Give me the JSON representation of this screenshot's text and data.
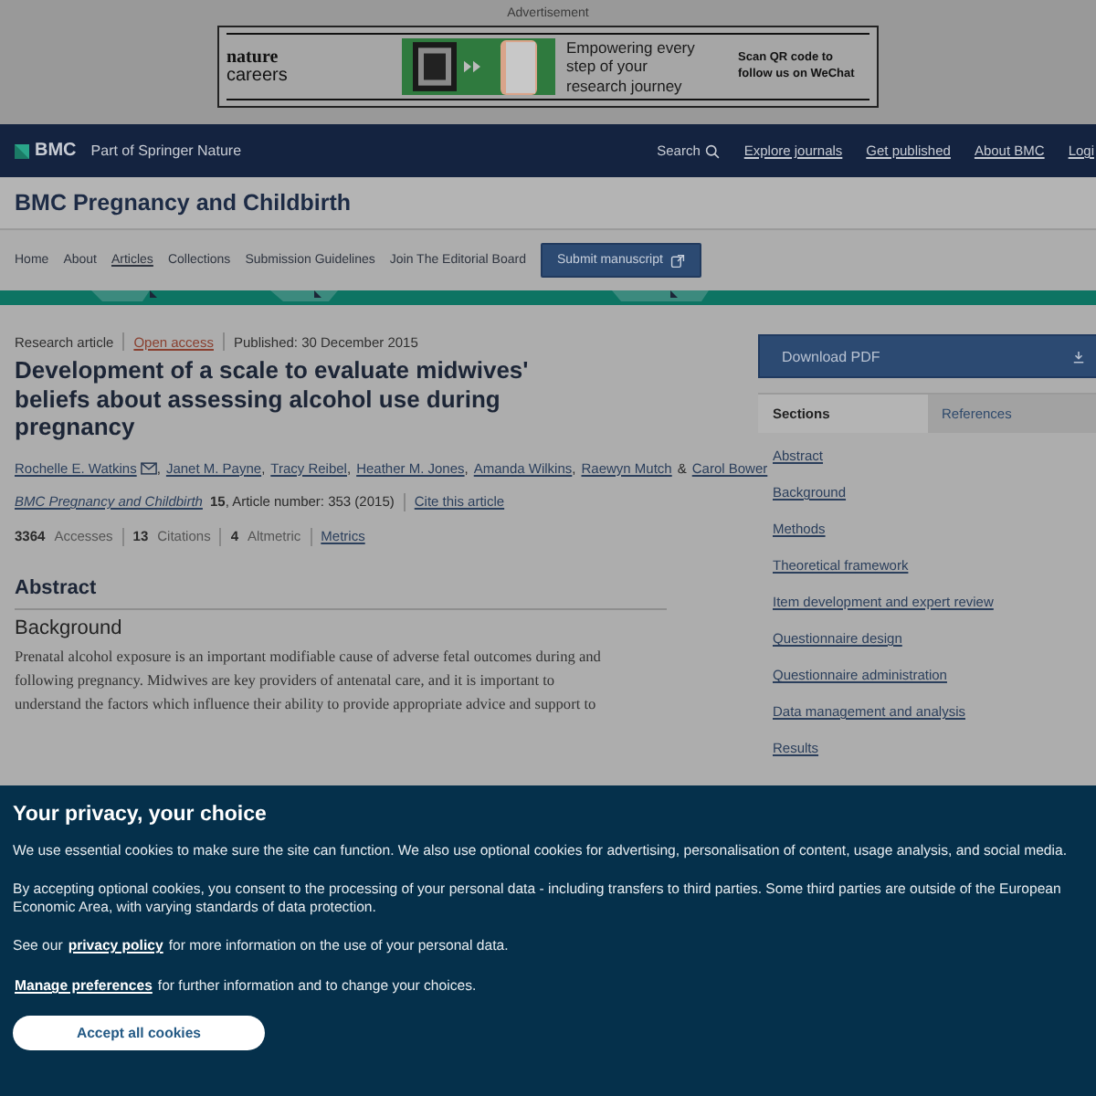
{
  "advertisement": {
    "label": "Advertisement",
    "brand": [
      "nature",
      "careers"
    ],
    "headline": [
      "Empowering every",
      "step of your",
      "research journey"
    ],
    "qr_text": [
      "Scan QR code to",
      "follow us on WeChat"
    ]
  },
  "top_nav": {
    "logo": "BMC",
    "tagline": "Part of Springer Nature",
    "items": [
      {
        "label": "Search",
        "kind": "search"
      },
      {
        "label": "Explore journals",
        "kind": "link"
      },
      {
        "label": "Get published",
        "kind": "link"
      },
      {
        "label": "About BMC",
        "kind": "link"
      },
      {
        "label": "Logi",
        "kind": "link"
      }
    ]
  },
  "journal_title": "BMC Pregnancy and Childbirth",
  "journal_nav": {
    "items": [
      {
        "label": "Home",
        "selected": false
      },
      {
        "label": "About",
        "selected": false
      },
      {
        "label": "Articles",
        "selected": true
      },
      {
        "label": "Collections",
        "selected": false
      },
      {
        "label": "Submission Guidelines",
        "selected": false
      },
      {
        "label": "Join The Editorial Board",
        "selected": false
      }
    ],
    "submit": "Submit manuscript"
  },
  "article": {
    "type": "Research article",
    "access": "Open access",
    "published": "Published: 30 December 2015",
    "title": "Development of a scale to evaluate midwives' beliefs about assessing alcohol use during pregnancy",
    "authors": [
      {
        "name": "Rochelle E. Watkins",
        "email": true,
        "sep": ","
      },
      {
        "name": "Janet M. Payne",
        "email": false,
        "sep": ","
      },
      {
        "name": "Tracy Reibel",
        "email": false,
        "sep": ","
      },
      {
        "name": "Heather M. Jones",
        "email": false,
        "sep": ","
      },
      {
        "name": "Amanda Wilkins",
        "email": false,
        "sep": ","
      },
      {
        "name": "Raewyn Mutch",
        "email": false,
        "sep": "&"
      },
      {
        "name": "Carol Bower",
        "email": false
      }
    ],
    "citation": {
      "journal": "BMC Pregnancy and Childbirth",
      "volume": "15",
      "rest": ", Article number: 353 (2015)",
      "cite": "Cite this article"
    },
    "metrics": [
      {
        "count": "3364",
        "label": "Accesses"
      },
      {
        "count": "13",
        "label": "Citations"
      },
      {
        "count": "4",
        "label": "Altmetric"
      }
    ],
    "metrics_link": "Metrics"
  },
  "abstract": {
    "heading": "Abstract",
    "subheading": "Background",
    "lines": [
      "Prenatal alcohol exposure is an important modifiable cause of adverse fetal outcomes during and",
      "following pregnancy. Midwives are key providers of antenatal care, and it is important to",
      "understand the factors which influence their ability to provide appropriate advice and support to"
    ]
  },
  "sidebar": {
    "download": "Download PDF",
    "tabs": [
      {
        "label": "Sections",
        "selected": true
      },
      {
        "label": "References",
        "selected": false
      }
    ],
    "sections": [
      "Abstract",
      "Background",
      "Methods",
      "Theoretical framework",
      "Item development and expert review",
      "Questionnaire design",
      "Questionnaire administration",
      "Data management and analysis",
      "Results"
    ]
  },
  "cookie_banner": {
    "title": "Your privacy, your choice",
    "paragraphs": [
      "We use essential cookies to make sure the site can function. We also use optional cookies for advertising, personalisation of content, usage analysis, and social media.",
      "By accepting optional cookies, you consent to the processing of your personal data - including transfers to third parties. Some third parties are outside of the European Economic Area, with varying standards of data protection."
    ],
    "policy": {
      "before": "See our",
      "link": "privacy policy",
      "after": "for more information on the use of your personal data."
    },
    "manage": {
      "link": "Manage preferences",
      "after": "for further information and to change your choices."
    },
    "accept": "Accept all cookies"
  }
}
